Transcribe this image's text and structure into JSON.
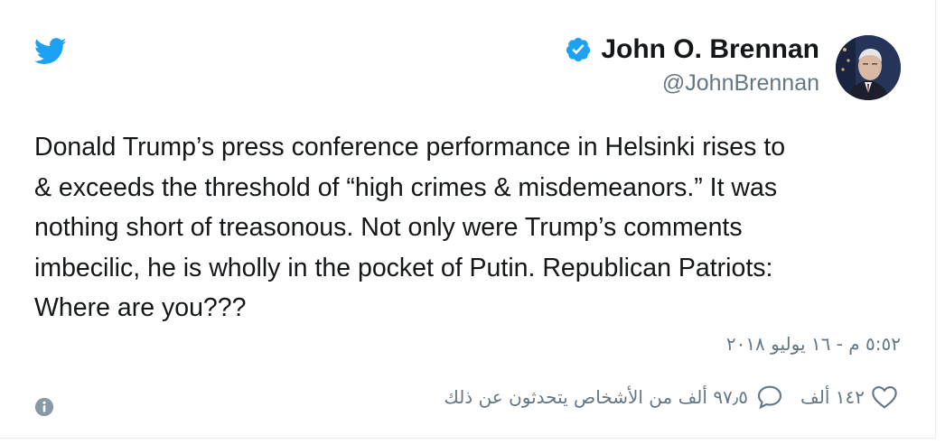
{
  "tweet": {
    "author": {
      "display_name": "John O. Brennan",
      "handle": "@JohnBrennan",
      "verified": true,
      "avatar_icon": "user-avatar"
    },
    "text": "Donald Trump’s press conference performance in Helsinki rises to\n& exceeds the threshold of “high crimes & misdemeanors.” It was\nnothing short of treasonous. Not only were Trump’s comments\nimbecilic, he is wholly in the pocket of Putin. Republican Patriots:\nWhere are you???",
    "timestamp": "٥:٥٢ م - ١٦ يوليو ٢٠١٨",
    "stats": {
      "likes": "١٤٢ ألف",
      "talking": "٩٧٫٥ ألف من الأشخاص يتحدثون عن ذلك"
    }
  },
  "icons": {
    "logo": "twitter-bird-icon",
    "verified": "verified-badge-icon",
    "heart": "heart-icon",
    "reply": "reply-bubble-icon",
    "info": "info-icon"
  },
  "colors": {
    "twitter_blue": "#1da1f2",
    "text_primary": "#14171a",
    "text_secondary": "#657786",
    "border": "#e6ecf0"
  }
}
